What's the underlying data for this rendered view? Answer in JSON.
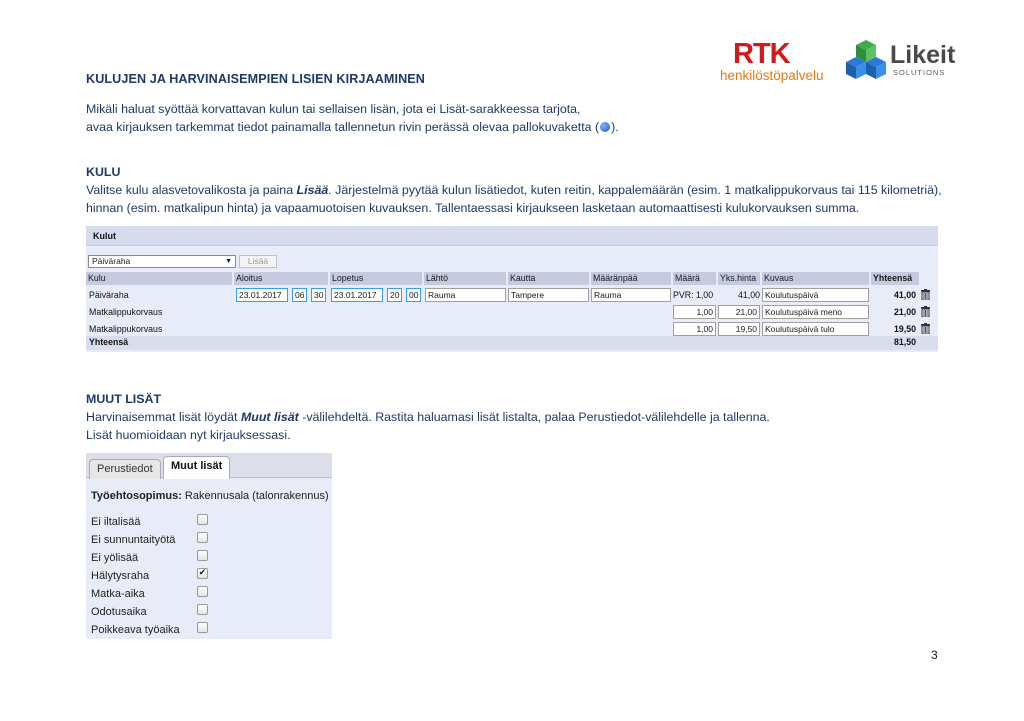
{
  "logos": {
    "rtk": "RTK",
    "rtk_sub": "henkilöstöpalvelu",
    "likeit": "Likeit",
    "likeit_sub": "SOLUTIONS"
  },
  "heading": "KULUJEN JA HARVINAISEMPIEN LISIEN KIRJAAMINEN",
  "intro": {
    "line1": "Mikäli haluat syöttää korvattavan kulun tai sellaisen lisän, jota ei Lisät-sarakkeessa tarjota,",
    "line2_before": "avaa kirjauksen tarkemmat tiedot painamalla tallennetun rivin perässä olevaa pallokuvaketta (",
    "line2_after": ")."
  },
  "kulu_section": {
    "title": "KULU",
    "line1_before": "Valitse kulu alasvetovalikosta ja paina ",
    "line1_bold": "Lisää",
    "line1_after": ". Järjestelmä pyytää kulun lisätiedot, kuten reitin, kappalemäärän (esim. 1 matkalippukorvaus tai 115 kilometriä),",
    "line2": "hinnan (esim. matkalipun hinta) ja vapaamuotoisen kuvauksen. Tallentaessasi kirjaukseen lasketaan automaattisesti kulukorvauksen summa."
  },
  "kulut_panel": {
    "title": "Kulut",
    "select_value": "Päiväraha",
    "add_button": "Lisää",
    "columns": [
      "Kulu",
      "Aloitus",
      "Lopetus",
      "Lähtö",
      "Kautta",
      "Määränpää",
      "Määrä",
      "Yks.hinta",
      "Kuvaus",
      "Yhteensä"
    ],
    "rows": [
      {
        "kulu": "Päiväraha",
        "start_date": "23.01.2017",
        "start_h": "06",
        "start_m": "30",
        "end_date": "23.01.2017",
        "end_h": "20",
        "end_m": "00",
        "lahto": "Rauma",
        "kautta": "Tampere",
        "maaranpaa": "Rauma",
        "maara": "PVR: 1,00",
        "hinta": "41,00",
        "kuvaus": "Koulutuspäivä",
        "yhteensa": "41,00"
      },
      {
        "kulu": "Matkalippukorvaus",
        "maara": "1,00",
        "hinta": "21,00",
        "kuvaus": "Koulutuspäivä meno",
        "yhteensa": "21,00"
      },
      {
        "kulu": "Matkalippukorvaus",
        "maara": "1,00",
        "hinta": "19,50",
        "kuvaus": "Koulutuspäivä tulo",
        "yhteensa": "19,50"
      }
    ],
    "total_label": "Yhteensä",
    "total_value": "81,50"
  },
  "muut_section": {
    "title": "MUUT LISÄT",
    "line1_before": "Harvinaisemmat lisät löydät ",
    "line1_bold": "Muut lisät",
    "line1_after": " -välilehdeltä. Rastita haluamasi lisät listalta, palaa Perustiedot-välilehdelle ja tallenna.",
    "line2": "Lisät huomioidaan nyt kirjauksessasi."
  },
  "tabs_panel": {
    "tab1": "Perustiedot",
    "tab2": "Muut lisät",
    "contract_label": "Työehtosopimus:",
    "contract_value": " Rakennusala (talonrakennus)",
    "items": [
      {
        "label": "Ei iltalisää",
        "checked": false,
        "mark": ""
      },
      {
        "label": "Ei sunnuntaityötä",
        "checked": false,
        "mark": ""
      },
      {
        "label": "Ei yölisää",
        "checked": false,
        "mark": ""
      },
      {
        "label": "Hälytysraha",
        "checked": true,
        "mark": "✔"
      },
      {
        "label": "Matka-aika",
        "checked": false,
        "mark": ""
      },
      {
        "label": "Odotusaika",
        "checked": false,
        "mark": ""
      },
      {
        "label": "Poikkeava työaika",
        "checked": false,
        "mark": ""
      }
    ]
  },
  "page_number": "3"
}
